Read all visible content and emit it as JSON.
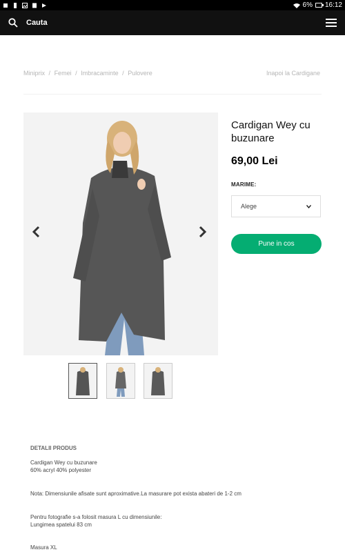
{
  "status_bar": {
    "battery": "6%",
    "time": "16:12"
  },
  "app_bar": {
    "search_label": "Cauta",
    "icons": [
      "search-icon",
      "menu-icon"
    ]
  },
  "breadcrumb": {
    "items": [
      "Miniprix",
      "Femei",
      "Imbracaminte",
      "Pulovere"
    ],
    "separator": "/",
    "back_link": "Inapoi la Cardigane"
  },
  "product": {
    "title": "Cardigan Wey cu buzunare",
    "price": "69,00 Lei",
    "size_label": "MARIME:",
    "size_select_value": "Alege",
    "add_to_cart": "Pune in cos",
    "accent_color": "#05ad72"
  },
  "details": {
    "heading": "DETALII PRODUS",
    "lines": [
      "Cardigan Wey cu buzunare",
      "60% acryl 40% polyester",
      "Nota: Dimensiunile afisate sunt aproximative.La masurare pot exista abateri de 1-2 cm",
      "Pentru fotografie s-a folosit masura L cu dimensiunile:",
      "Lungimea spatelui 83 cm",
      "Masura XL"
    ]
  }
}
